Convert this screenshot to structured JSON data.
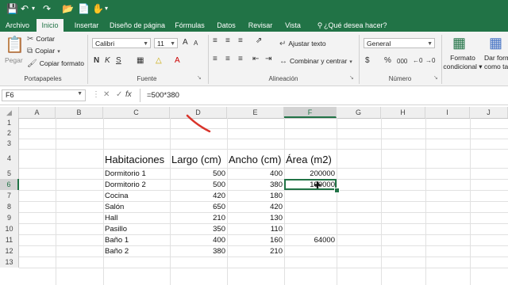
{
  "quick_access": {
    "save_icon": "save-icon",
    "undo_icon": "undo-icon",
    "redo_icon": "redo-icon",
    "open_icon": "open-icon",
    "touch_icon": "touch-icon"
  },
  "tabs": [
    "Archivo",
    "Inicio",
    "Insertar",
    "Diseño de página",
    "Fórmulas",
    "Datos",
    "Revisar",
    "Vista"
  ],
  "tell_me": "¿Qué desea hacer?",
  "clipboard": {
    "paste": "Pegar",
    "cut": "Cortar",
    "copy": "Copiar",
    "format_painter": "Copiar formato",
    "group": "Portapapeles"
  },
  "font": {
    "name": "Calibri",
    "size": "11",
    "bold": "N",
    "italic": "K",
    "underline": "S",
    "grow": "A",
    "shrink": "A",
    "group": "Fuente"
  },
  "alignment": {
    "wrap": "Ajustar texto",
    "merge": "Combinar y centrar",
    "group": "Alineación"
  },
  "number": {
    "format": "General",
    "currency": "$",
    "percent": "%",
    "comma": "000",
    "group": "Número"
  },
  "styles": {
    "conditional": "Formato condicional",
    "conditional_line1": "Formato",
    "conditional_line2": "condicional",
    "as_table_line1": "Dar form",
    "as_table_line2": "como ta"
  },
  "formula_bar": {
    "name_box": "F6",
    "cancel": "✕",
    "enter": "✓",
    "fx": "fx",
    "formula": "=500*380"
  },
  "columns": [
    "A",
    "B",
    "C",
    "D",
    "E",
    "F",
    "G",
    "H",
    "I",
    "J"
  ],
  "rows": [
    "1",
    "2",
    "3",
    "4",
    "5",
    "6",
    "7",
    "8",
    "9",
    "10",
    "11",
    "12",
    "13"
  ],
  "headers": {
    "c": "Habitaciones",
    "d": "Largo (cm)",
    "e": "Ancho (cm)",
    "f": "Área (m2)"
  },
  "table": [
    {
      "name": "Dormitorio 1",
      "largo": "500",
      "ancho": "400",
      "area": "200000"
    },
    {
      "name": "Dormitorio 2",
      "largo": "500",
      "ancho": "380",
      "area": "190000"
    },
    {
      "name": "Cocina",
      "largo": "420",
      "ancho": "180",
      "area": ""
    },
    {
      "name": "Salón",
      "largo": "650",
      "ancho": "420",
      "area": ""
    },
    {
      "name": "Hall",
      "largo": "210",
      "ancho": "130",
      "area": ""
    },
    {
      "name": "Pasillo",
      "largo": "350",
      "ancho": "110",
      "area": ""
    },
    {
      "name": "Baño 1",
      "largo": "400",
      "ancho": "160",
      "area": "64000"
    },
    {
      "name": "Baño 2",
      "largo": "380",
      "ancho": "210",
      "area": ""
    }
  ],
  "colors": {
    "excel_green": "#217346",
    "annotation_red": "#d9342b"
  }
}
